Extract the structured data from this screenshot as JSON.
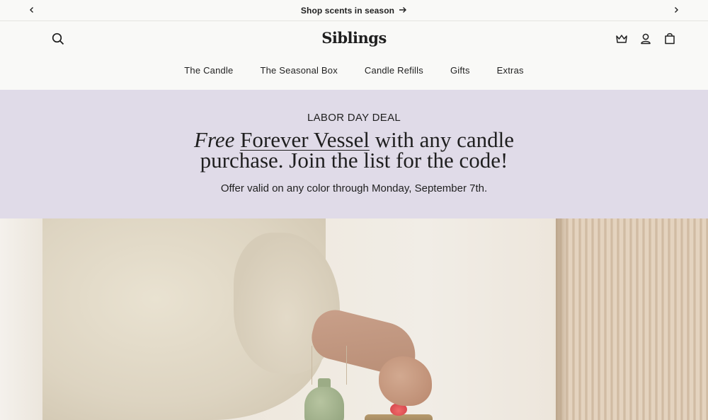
{
  "announcement": {
    "text": "Shop scents in season",
    "prev_icon": "chevron-left-icon",
    "next_icon": "chevron-right-icon",
    "arrow_icon": "arrow-right-icon"
  },
  "header": {
    "logo": "Siblings",
    "icons": [
      "search-icon",
      "crown-icon",
      "account-icon",
      "bag-icon"
    ]
  },
  "nav": {
    "items": [
      "The Candle",
      "The Seasonal Box",
      "Candle Refills",
      "Gifts",
      "Extras"
    ]
  },
  "promo": {
    "eyebrow": "LABOR DAY DEAL",
    "headline_free": "Free",
    "headline_link": "Forever Vessel",
    "headline_rest_1": "with any candle",
    "headline_rest_2": "purchase. Join the list for the code!",
    "subtext": "Offer valid on any color through Monday, September 7th.",
    "background": "#e0dbe8"
  },
  "hero": {
    "image_alt": "Person lighting a candle next to a small vase"
  },
  "colors": {
    "page_bg": "#f9f9f7",
    "text": "#1f1f1f",
    "promo_bg": "#e0dbe8"
  }
}
